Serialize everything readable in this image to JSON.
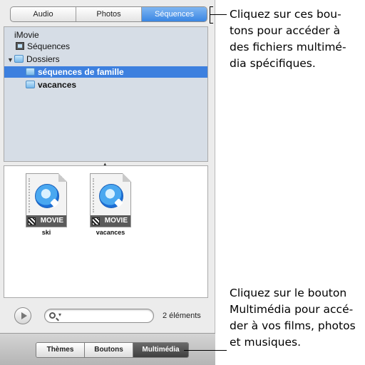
{
  "source_tabs": {
    "items": [
      {
        "label": "Audio"
      },
      {
        "label": "Photos"
      },
      {
        "label": "Séquences"
      }
    ],
    "selected": "Séquences"
  },
  "tree": {
    "root": "iMovie",
    "sequences": "Séquences",
    "folders": "Dossiers",
    "family": "séquences de famille",
    "vacation": "vacances"
  },
  "files": [
    {
      "name": "ski",
      "badge": "MOVIE",
      "icon": "quicktime-movie-icon"
    },
    {
      "name": "vacances",
      "badge": "MOVIE",
      "icon": "quicktime-movie-icon"
    }
  ],
  "footer": {
    "search_placeholder": "",
    "count": "2 éléments"
  },
  "bottom_tabs": {
    "items": [
      {
        "label": "Thèmes"
      },
      {
        "label": "Boutons"
      },
      {
        "label": "Multimédia"
      }
    ],
    "selected": "Multimédia"
  },
  "callouts": {
    "top": "Cliquez sur ces bou-\ntons pour accéder à\ndes fichiers multimé-\ndia spécifiques.",
    "bottom": "Cliquez sur le bouton\nMultimédia pour accé-\nder à vos films, photos\net musiques."
  },
  "colors": {
    "selection": "#3d80df",
    "active_segment": "#3a86e3",
    "active_tab": "#4f4f4f"
  }
}
